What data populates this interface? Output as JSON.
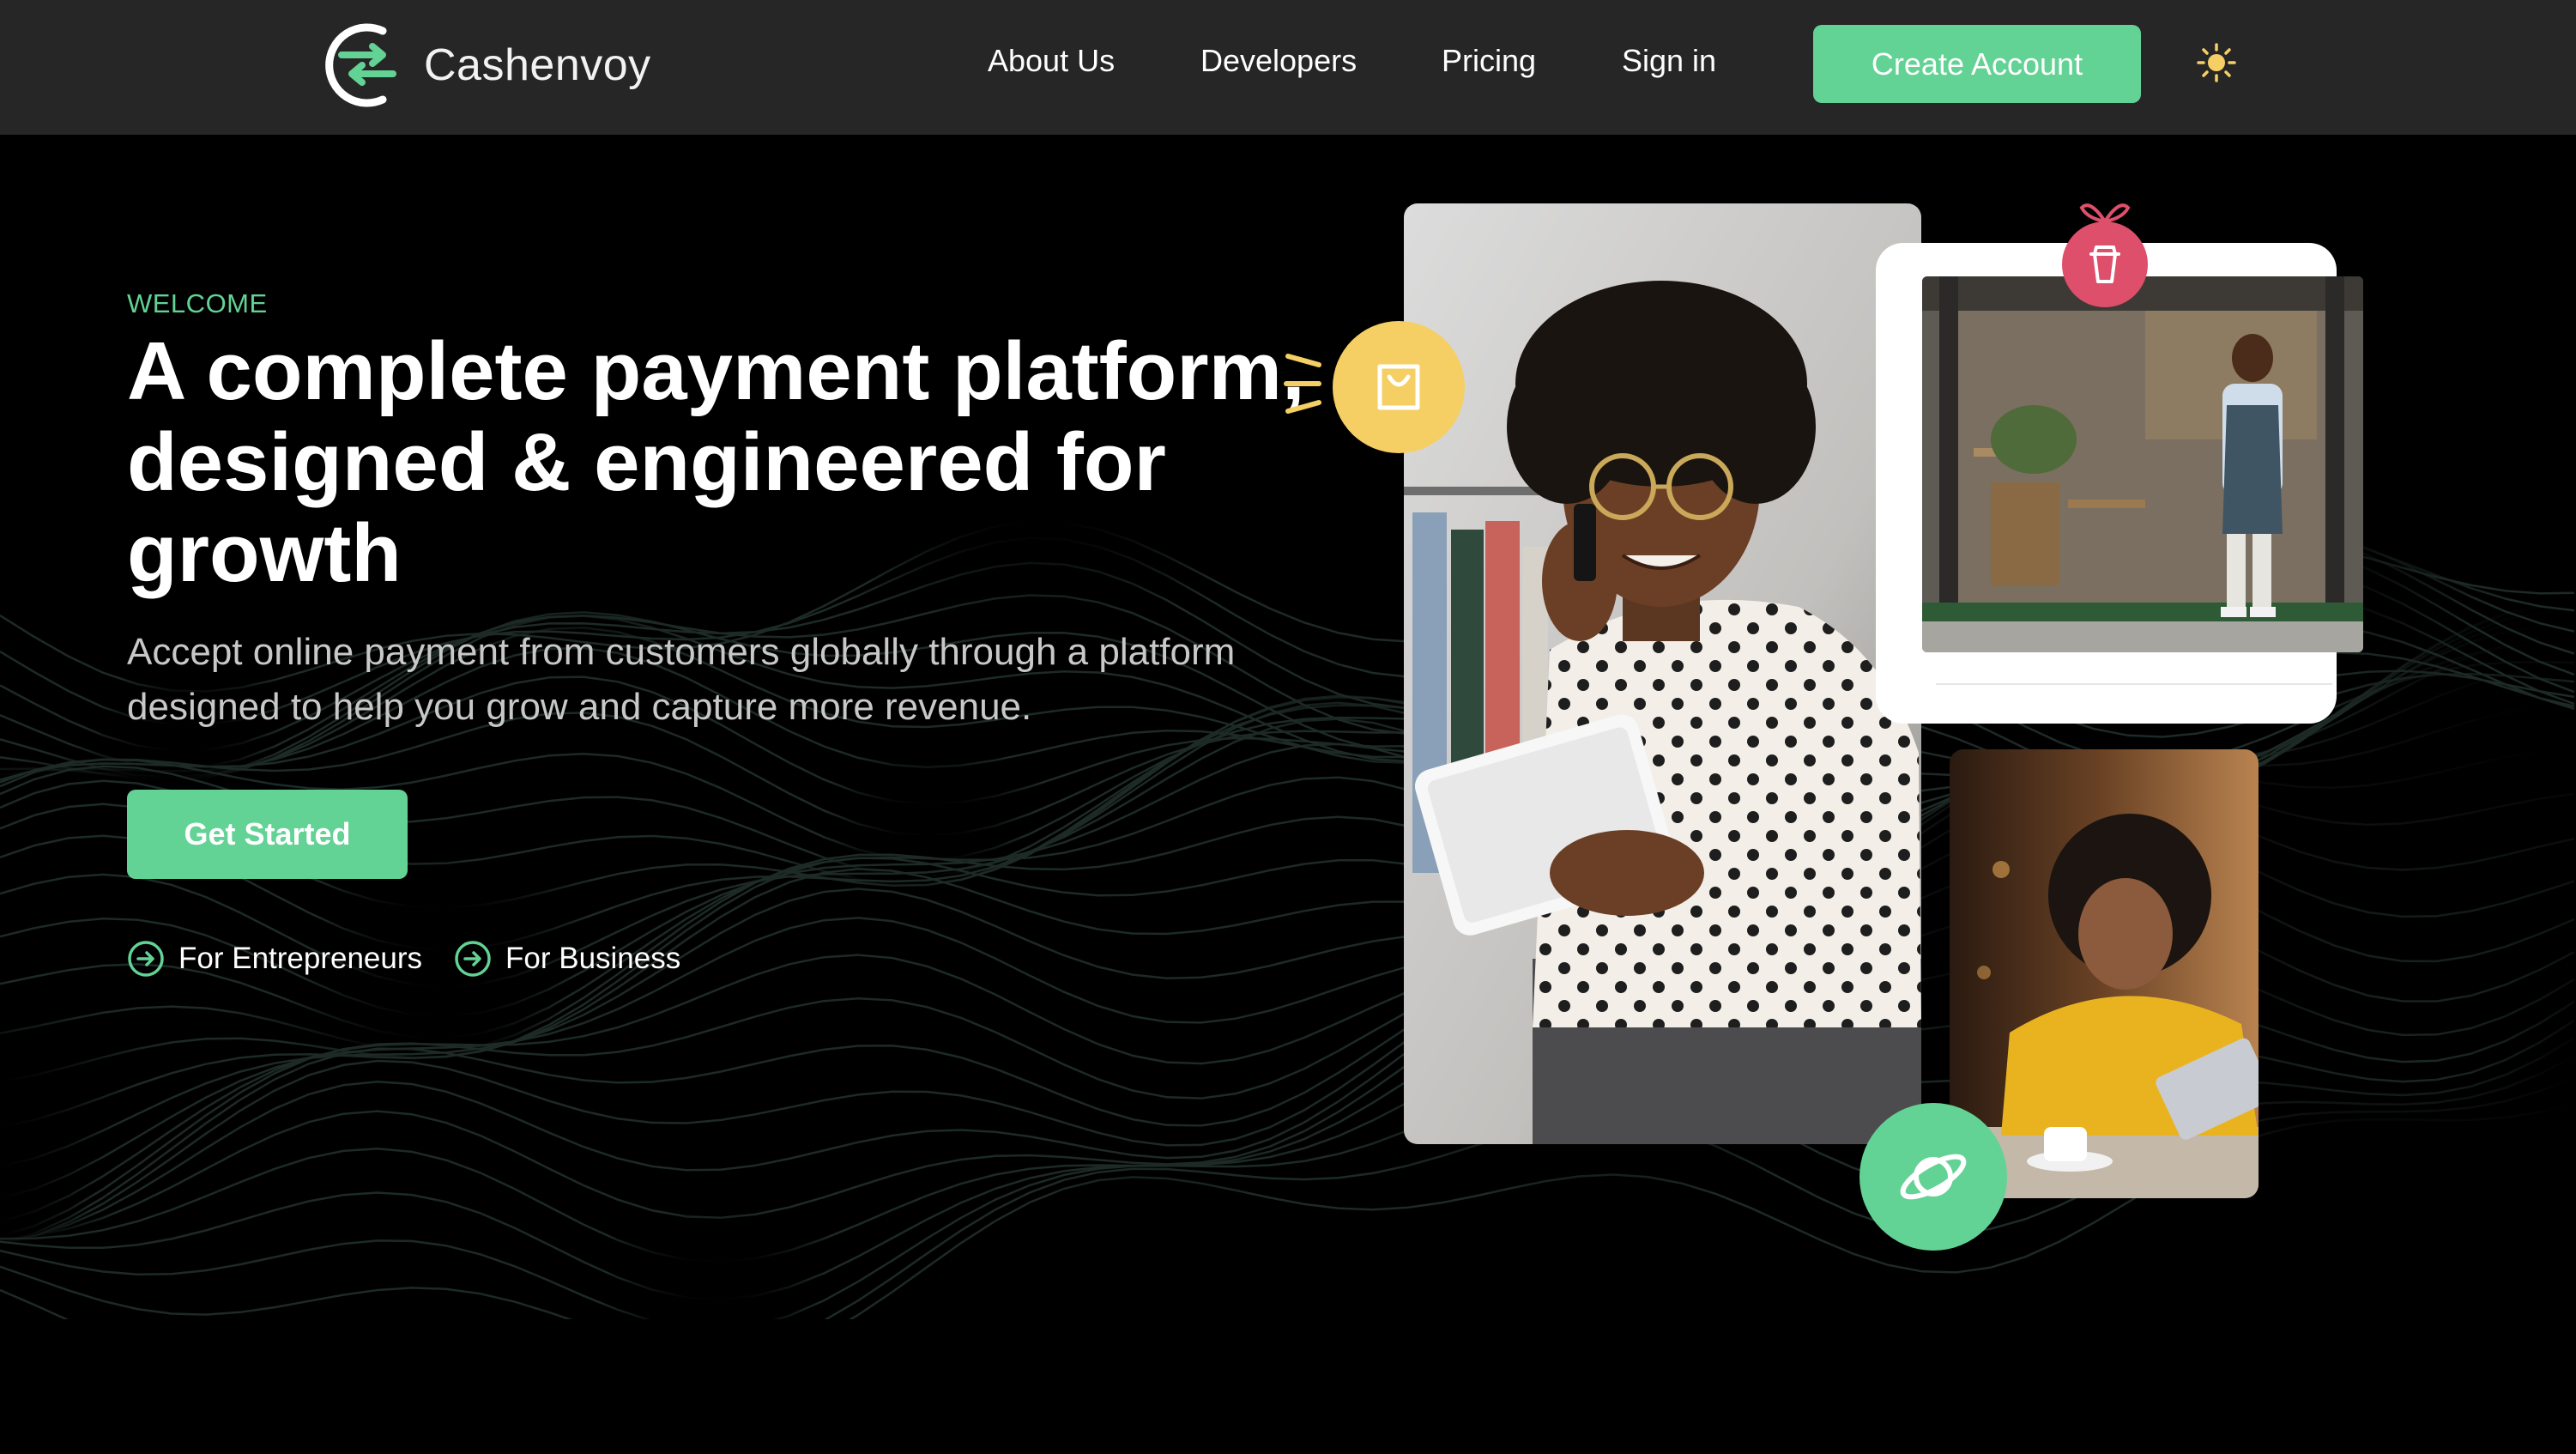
{
  "header": {
    "brand": "Cashenvoy",
    "nav": [
      {
        "label": "About Us"
      },
      {
        "label": "Developers"
      },
      {
        "label": "Pricing"
      },
      {
        "label": "Sign in"
      }
    ],
    "cta_label": "Create Account",
    "theme_toggle_icon": "sun-icon"
  },
  "hero": {
    "eyebrow": "WELCOME",
    "headline": "A complete payment platform, designed & engineered for growth",
    "subtext": "Accept online payment from customers globally through a platform designed to help you grow and capture more revenue.",
    "primary_button": "Get Started",
    "links": [
      {
        "label": "For Entrepreneurs",
        "icon": "arrow-circle-right-icon"
      },
      {
        "label": "For Business",
        "icon": "arrow-circle-right-icon"
      }
    ]
  },
  "collage": {
    "badges": [
      {
        "icon": "shopping-bag-icon",
        "color": "#f5cf63"
      },
      {
        "icon": "cup-icon",
        "color": "#de4f6b"
      },
      {
        "icon": "planet-icon",
        "color": "#63d295"
      }
    ]
  },
  "colors": {
    "accent": "#63d295",
    "header_bg": "#262626",
    "page_bg": "#000000",
    "yellow": "#f5cf63",
    "pink": "#de4f6b"
  }
}
